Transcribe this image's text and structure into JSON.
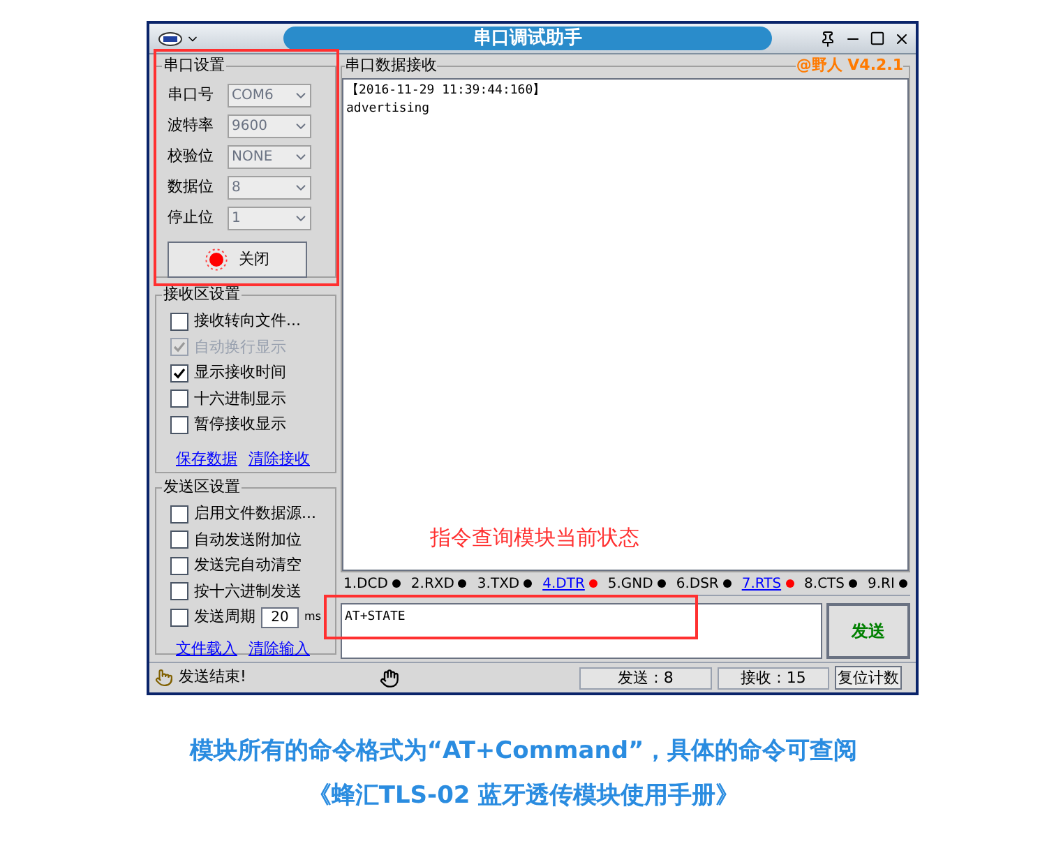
{
  "window": {
    "title": "串口调试助手"
  },
  "serial_settings": {
    "title": "串口设置",
    "fields": [
      {
        "label": "串口号",
        "value": "COM6"
      },
      {
        "label": "波特率",
        "value": "9600"
      },
      {
        "label": "校验位",
        "value": "NONE"
      },
      {
        "label": "数据位",
        "value": "8"
      },
      {
        "label": "停止位",
        "value": "1"
      }
    ],
    "button": {
      "label": "关闭",
      "on": true
    }
  },
  "receive_settings": {
    "title": "接收区设置",
    "options": [
      {
        "label": "接收转向文件...",
        "checked": false,
        "disabled": false
      },
      {
        "label": "自动换行显示",
        "checked": true,
        "disabled": true
      },
      {
        "label": "显示接收时间",
        "checked": true,
        "disabled": false
      },
      {
        "label": "十六进制显示",
        "checked": false,
        "disabled": false
      },
      {
        "label": "暂停接收显示",
        "checked": false,
        "disabled": false
      }
    ],
    "links": [
      "保存数据",
      "清除接收"
    ]
  },
  "send_settings": {
    "title": "发送区设置",
    "options": [
      {
        "label": "启用文件数据源...",
        "checked": false
      },
      {
        "label": "自动发送附加位",
        "checked": false
      },
      {
        "label": "发送完自动清空",
        "checked": false
      },
      {
        "label": "按十六进制发送",
        "checked": false
      }
    ],
    "period": {
      "label": "发送周期",
      "checked": false,
      "value": "20",
      "unit": "ms"
    },
    "links": [
      "文件载入",
      "清除输入"
    ]
  },
  "receive_panel": {
    "title": "串口数据接收",
    "version": "@野人 V4.2.1",
    "lines": [
      "【2016-11-29 11:39:44:160】",
      "advertising"
    ]
  },
  "pins": [
    {
      "label": "1.DCD",
      "color": "#000000",
      "link": false
    },
    {
      "label": "2.RXD",
      "color": "#000000",
      "link": false
    },
    {
      "label": "3.TXD",
      "color": "#000000",
      "link": false
    },
    {
      "label": "4.DTR",
      "color": "#ff0000",
      "link": true
    },
    {
      "label": "5.GND",
      "color": "#000000",
      "link": false
    },
    {
      "label": "6.DSR",
      "color": "#000000",
      "link": false
    },
    {
      "label": "7.RTS",
      "color": "#ff0000",
      "link": true
    },
    {
      "label": "8.CTS",
      "color": "#000000",
      "link": false
    },
    {
      "label": "9.RI",
      "color": "#000000",
      "link": false
    }
  ],
  "send_input": {
    "value": "AT+STATE"
  },
  "send_button": "发送",
  "status_bar": {
    "message": "发送结束!",
    "sent": "发送 : 8",
    "received": "接收 : 15",
    "reset": "复位计数"
  },
  "annotation": "指令查询模块当前状态",
  "caption": [
    "模块所有的命令格式为“AT+Command”，具体的命令可查阅",
    "《蜂汇TLS-02 蓝牙透传模块使用手册》"
  ]
}
